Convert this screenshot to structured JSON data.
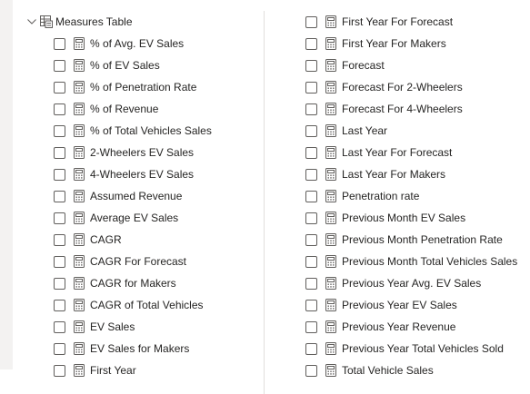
{
  "tree": {
    "table_name": "Measures Table",
    "left_fields": [
      "% of Avg. EV Sales",
      "% of EV Sales",
      "% of Penetration Rate",
      "% of Revenue",
      "% of Total Vehicles Sales",
      "2-Wheelers EV Sales",
      "4-Wheelers EV Sales",
      "Assumed Revenue",
      "Average EV Sales",
      "CAGR",
      "CAGR For Forecast",
      "CAGR for Makers",
      "CAGR of Total Vehicles",
      "EV Sales",
      "EV Sales for Makers",
      "First Year"
    ],
    "right_fields": [
      "First Year For Forecast",
      "First Year For Makers",
      "Forecast",
      "Forecast For 2-Wheelers",
      "Forecast For 4-Wheelers",
      "Last Year",
      "Last Year For Forecast",
      "Last Year For Makers",
      "Penetration rate",
      "Previous Month EV Sales",
      "Previous Month Penetration Rate",
      "Previous Month Total Vehicles Sales",
      "Previous Year Avg. EV Sales",
      "Previous Year EV Sales",
      "Previous Year Revenue",
      "Previous Year Total Vehicles Sold",
      "Total Vehicle Sales"
    ]
  },
  "icons": {
    "expand": "chevron-down-icon",
    "table": "table-icon",
    "measure": "calculator-icon"
  },
  "colors": {
    "text": "#252423",
    "icon": "#605e5c",
    "divider": "#e1dfdd"
  }
}
